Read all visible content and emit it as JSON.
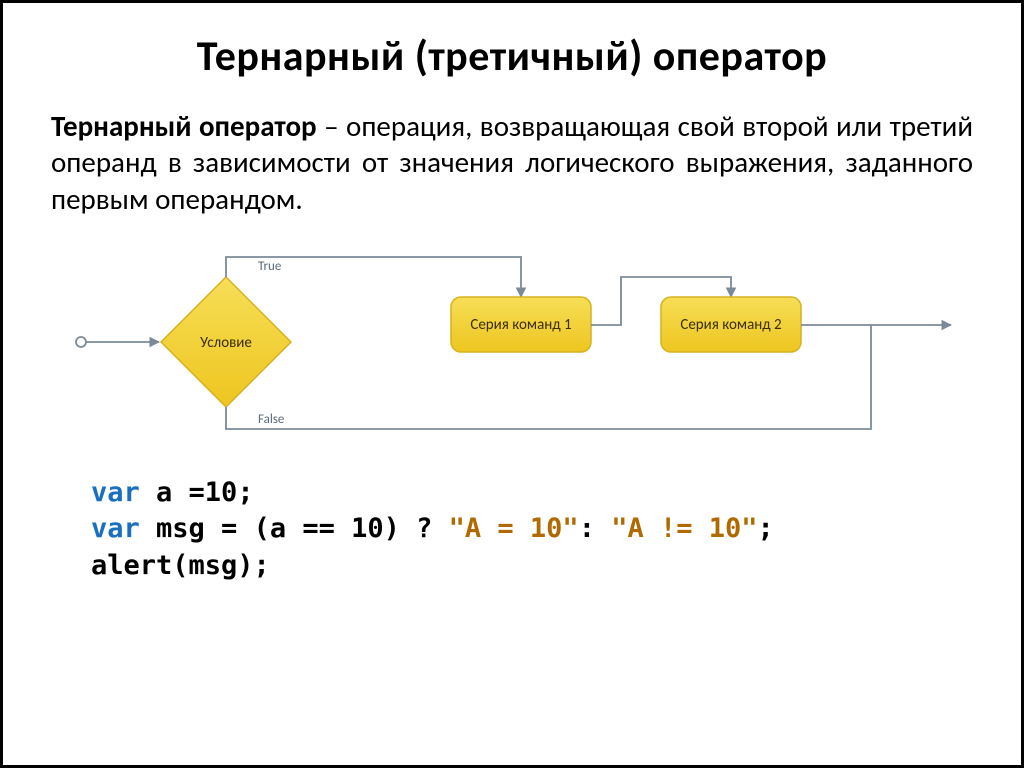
{
  "title": "Тернарный (третичный) оператор",
  "definition": {
    "term": "Тернарный оператор",
    "rest": " – операция, возвращающая свой второй или третий операнд в зависимости от значения логического выражения,  заданного первым операндом."
  },
  "diagram": {
    "true_label": "True",
    "false_label": "False",
    "condition": "Условие",
    "block1": "Серия команд 1",
    "block2": "Серия команд 2"
  },
  "code": {
    "line1_kw": "var",
    "line1_rest": " a =10;",
    "line2_kw": "var",
    "line2_mid": " msg = (a == 10) ? ",
    "line2_str1": "\"A = 10\"",
    "line2_sep": ": ",
    "line2_str2": "\"A != 10\"",
    "line2_end": ";",
    "line3": "alert(msg);"
  },
  "colors": {
    "shape_fill": "#f2d034",
    "shape_stroke": "#d6b21f",
    "arrow": "#7b8a99"
  }
}
